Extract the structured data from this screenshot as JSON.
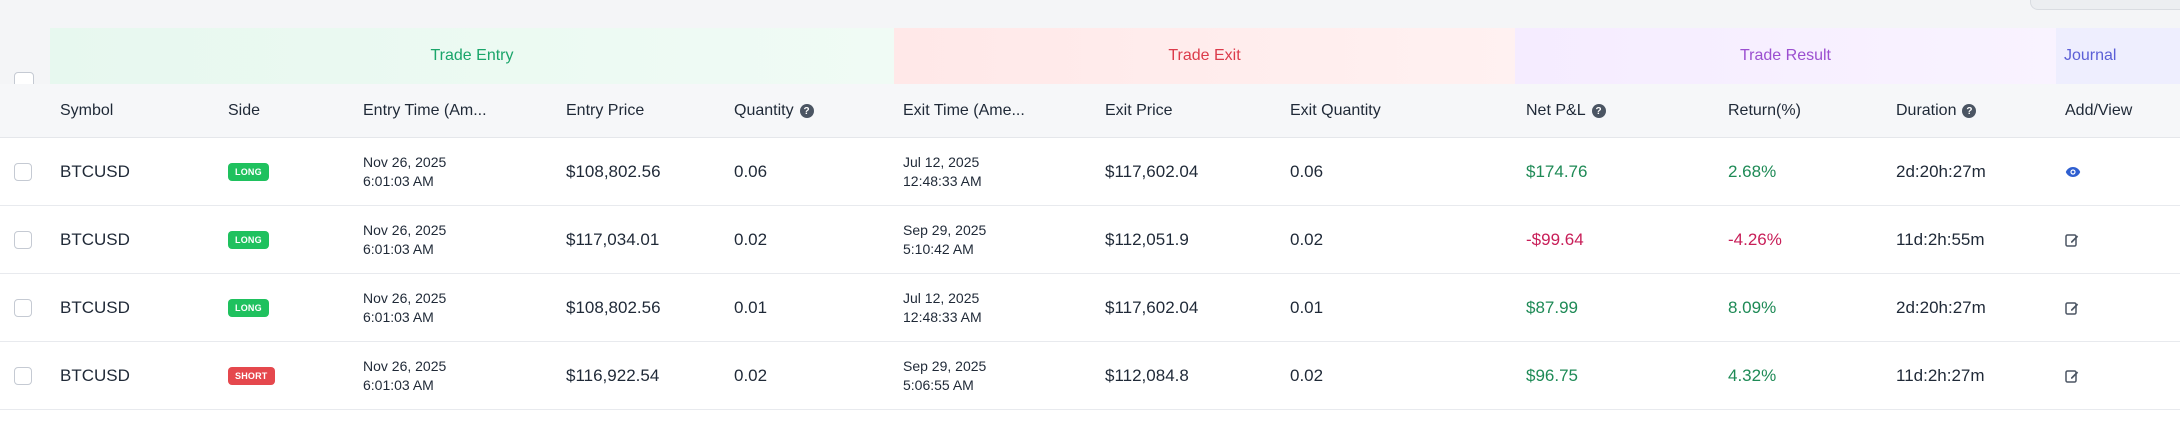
{
  "groups": {
    "entry": "Trade Entry",
    "exit": "Trade Exit",
    "result": "Trade Result",
    "journal": "Journal"
  },
  "headers": {
    "symbol": "Symbol",
    "side": "Side",
    "entry_time": "Entry Time (Am...",
    "entry_price": "Entry Price",
    "quantity": "Quantity",
    "exit_time": "Exit Time (Ame...",
    "exit_price": "Exit Price",
    "exit_quantity": "Exit Quantity",
    "net_pnl": "Net P&L",
    "return": "Return(%)",
    "duration": "Duration",
    "journal": "Add/View"
  },
  "icons": {
    "help": "question-circle-icon",
    "view": "eye-icon",
    "edit": "edit-icon"
  },
  "colors": {
    "positive": "#1e8a56",
    "negative": "#c81e58",
    "long": "#1fc15e",
    "short": "#e5484d",
    "entry_accent": "#1aa56a",
    "exit_accent": "#dc3b4b",
    "result_accent": "#9b4fd0",
    "journal_accent": "#5b5fd6",
    "view_icon": "#2f5fd0"
  },
  "rows": [
    {
      "symbol": "BTCUSD",
      "side": "LONG",
      "entry_date": "Nov 26, 2025",
      "entry_time": "6:01:03 AM",
      "entry_price": "$108,802.56",
      "quantity": "0.06",
      "exit_date": "Jul 12, 2025",
      "exit_time": "12:48:33 AM",
      "exit_price": "$117,602.04",
      "exit_quantity": "0.06",
      "net_pnl": "$174.76",
      "return": "2.68%",
      "duration": "2d:20h:27m",
      "journal": "view"
    },
    {
      "symbol": "BTCUSD",
      "side": "LONG",
      "entry_date": "Nov 26, 2025",
      "entry_time": "6:01:03 AM",
      "entry_price": "$117,034.01",
      "quantity": "0.02",
      "exit_date": "Sep 29, 2025",
      "exit_time": "5:10:42 AM",
      "exit_price": "$112,051.9",
      "exit_quantity": "0.02",
      "net_pnl": "-$99.64",
      "return": "-4.26%",
      "duration": "11d:2h:55m",
      "journal": "edit"
    },
    {
      "symbol": "BTCUSD",
      "side": "LONG",
      "entry_date": "Nov 26, 2025",
      "entry_time": "6:01:03 AM",
      "entry_price": "$108,802.56",
      "quantity": "0.01",
      "exit_date": "Jul 12, 2025",
      "exit_time": "12:48:33 AM",
      "exit_price": "$117,602.04",
      "exit_quantity": "0.01",
      "net_pnl": "$87.99",
      "return": "8.09%",
      "duration": "2d:20h:27m",
      "journal": "edit"
    },
    {
      "symbol": "BTCUSD",
      "side": "SHORT",
      "entry_date": "Nov 26, 2025",
      "entry_time": "6:01:03 AM",
      "entry_price": "$116,922.54",
      "quantity": "0.02",
      "exit_date": "Sep 29, 2025",
      "exit_time": "5:06:55 AM",
      "exit_price": "$112,084.8",
      "exit_quantity": "0.02",
      "net_pnl": "$96.75",
      "return": "4.32%",
      "duration": "11d:2h:27m",
      "journal": "edit"
    }
  ]
}
